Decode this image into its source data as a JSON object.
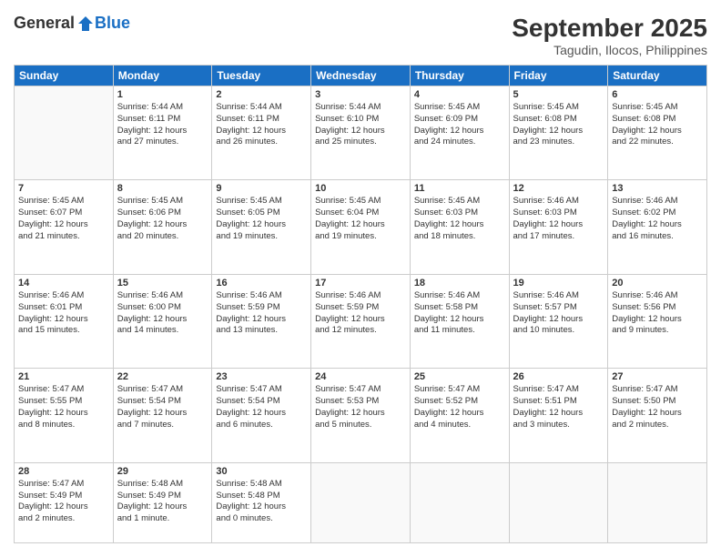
{
  "header": {
    "logo_general": "General",
    "logo_blue": "Blue",
    "month_title": "September 2025",
    "subtitle": "Tagudin, Ilocos, Philippines"
  },
  "days": [
    "Sunday",
    "Monday",
    "Tuesday",
    "Wednesday",
    "Thursday",
    "Friday",
    "Saturday"
  ],
  "weeks": [
    [
      {
        "day": "",
        "info": ""
      },
      {
        "day": "1",
        "info": "Sunrise: 5:44 AM\nSunset: 6:11 PM\nDaylight: 12 hours\nand 27 minutes."
      },
      {
        "day": "2",
        "info": "Sunrise: 5:44 AM\nSunset: 6:11 PM\nDaylight: 12 hours\nand 26 minutes."
      },
      {
        "day": "3",
        "info": "Sunrise: 5:44 AM\nSunset: 6:10 PM\nDaylight: 12 hours\nand 25 minutes."
      },
      {
        "day": "4",
        "info": "Sunrise: 5:45 AM\nSunset: 6:09 PM\nDaylight: 12 hours\nand 24 minutes."
      },
      {
        "day": "5",
        "info": "Sunrise: 5:45 AM\nSunset: 6:08 PM\nDaylight: 12 hours\nand 23 minutes."
      },
      {
        "day": "6",
        "info": "Sunrise: 5:45 AM\nSunset: 6:08 PM\nDaylight: 12 hours\nand 22 minutes."
      }
    ],
    [
      {
        "day": "7",
        "info": "Sunrise: 5:45 AM\nSunset: 6:07 PM\nDaylight: 12 hours\nand 21 minutes."
      },
      {
        "day": "8",
        "info": "Sunrise: 5:45 AM\nSunset: 6:06 PM\nDaylight: 12 hours\nand 20 minutes."
      },
      {
        "day": "9",
        "info": "Sunrise: 5:45 AM\nSunset: 6:05 PM\nDaylight: 12 hours\nand 19 minutes."
      },
      {
        "day": "10",
        "info": "Sunrise: 5:45 AM\nSunset: 6:04 PM\nDaylight: 12 hours\nand 19 minutes."
      },
      {
        "day": "11",
        "info": "Sunrise: 5:45 AM\nSunset: 6:03 PM\nDaylight: 12 hours\nand 18 minutes."
      },
      {
        "day": "12",
        "info": "Sunrise: 5:46 AM\nSunset: 6:03 PM\nDaylight: 12 hours\nand 17 minutes."
      },
      {
        "day": "13",
        "info": "Sunrise: 5:46 AM\nSunset: 6:02 PM\nDaylight: 12 hours\nand 16 minutes."
      }
    ],
    [
      {
        "day": "14",
        "info": "Sunrise: 5:46 AM\nSunset: 6:01 PM\nDaylight: 12 hours\nand 15 minutes."
      },
      {
        "day": "15",
        "info": "Sunrise: 5:46 AM\nSunset: 6:00 PM\nDaylight: 12 hours\nand 14 minutes."
      },
      {
        "day": "16",
        "info": "Sunrise: 5:46 AM\nSunset: 5:59 PM\nDaylight: 12 hours\nand 13 minutes."
      },
      {
        "day": "17",
        "info": "Sunrise: 5:46 AM\nSunset: 5:59 PM\nDaylight: 12 hours\nand 12 minutes."
      },
      {
        "day": "18",
        "info": "Sunrise: 5:46 AM\nSunset: 5:58 PM\nDaylight: 12 hours\nand 11 minutes."
      },
      {
        "day": "19",
        "info": "Sunrise: 5:46 AM\nSunset: 5:57 PM\nDaylight: 12 hours\nand 10 minutes."
      },
      {
        "day": "20",
        "info": "Sunrise: 5:46 AM\nSunset: 5:56 PM\nDaylight: 12 hours\nand 9 minutes."
      }
    ],
    [
      {
        "day": "21",
        "info": "Sunrise: 5:47 AM\nSunset: 5:55 PM\nDaylight: 12 hours\nand 8 minutes."
      },
      {
        "day": "22",
        "info": "Sunrise: 5:47 AM\nSunset: 5:54 PM\nDaylight: 12 hours\nand 7 minutes."
      },
      {
        "day": "23",
        "info": "Sunrise: 5:47 AM\nSunset: 5:54 PM\nDaylight: 12 hours\nand 6 minutes."
      },
      {
        "day": "24",
        "info": "Sunrise: 5:47 AM\nSunset: 5:53 PM\nDaylight: 12 hours\nand 5 minutes."
      },
      {
        "day": "25",
        "info": "Sunrise: 5:47 AM\nSunset: 5:52 PM\nDaylight: 12 hours\nand 4 minutes."
      },
      {
        "day": "26",
        "info": "Sunrise: 5:47 AM\nSunset: 5:51 PM\nDaylight: 12 hours\nand 3 minutes."
      },
      {
        "day": "27",
        "info": "Sunrise: 5:47 AM\nSunset: 5:50 PM\nDaylight: 12 hours\nand 2 minutes."
      }
    ],
    [
      {
        "day": "28",
        "info": "Sunrise: 5:47 AM\nSunset: 5:49 PM\nDaylight: 12 hours\nand 2 minutes."
      },
      {
        "day": "29",
        "info": "Sunrise: 5:48 AM\nSunset: 5:49 PM\nDaylight: 12 hours\nand 1 minute."
      },
      {
        "day": "30",
        "info": "Sunrise: 5:48 AM\nSunset: 5:48 PM\nDaylight: 12 hours\nand 0 minutes."
      },
      {
        "day": "",
        "info": ""
      },
      {
        "day": "",
        "info": ""
      },
      {
        "day": "",
        "info": ""
      },
      {
        "day": "",
        "info": ""
      }
    ]
  ]
}
